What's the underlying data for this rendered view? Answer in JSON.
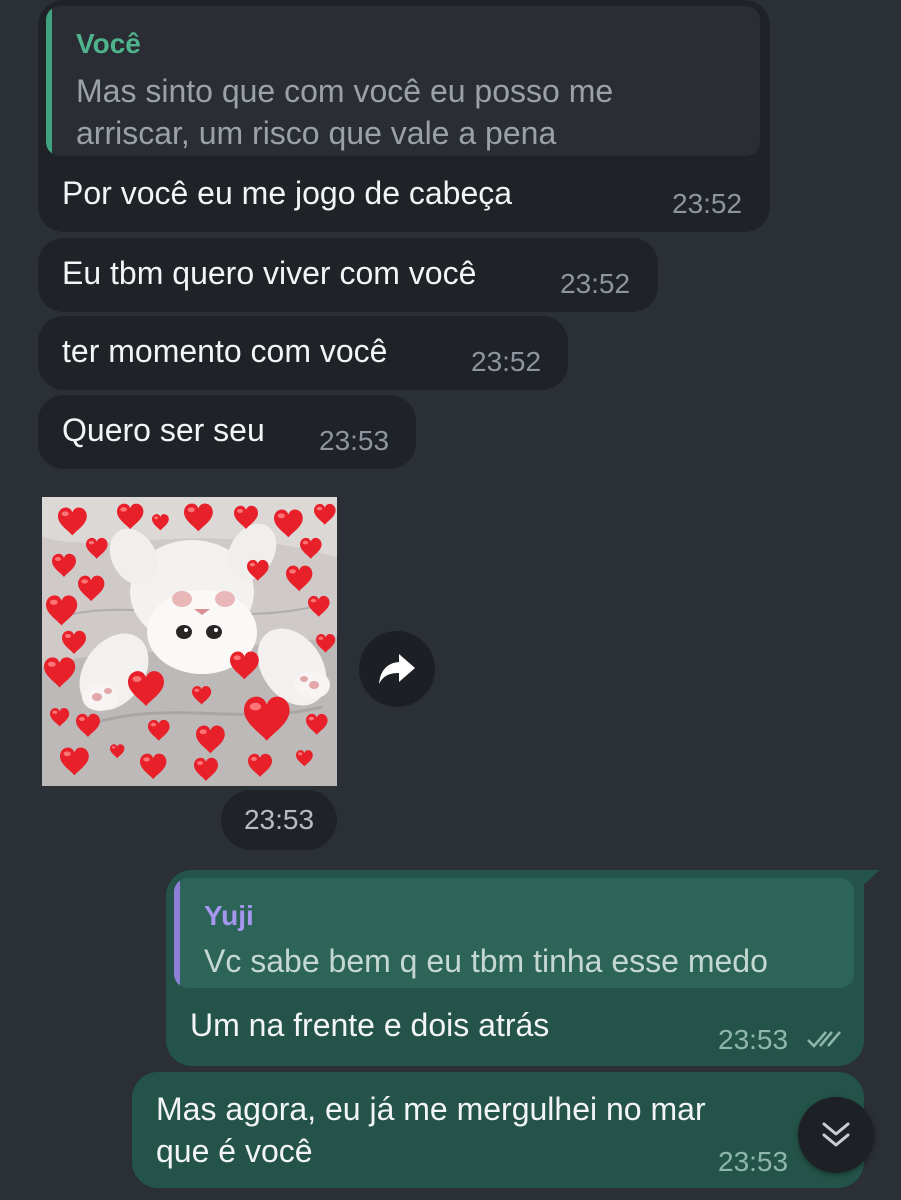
{
  "messages": {
    "m1": {
      "quote_author": "Você",
      "quote_line1": "Mas sinto que com você eu posso me",
      "quote_line2": "arriscar, um risco que vale a pena",
      "text": "Por você eu me jogo de cabeça",
      "time": "23:52"
    },
    "m2": {
      "text": "Eu tbm quero viver com você",
      "time": "23:52"
    },
    "m3": {
      "text": "ter momento com você",
      "time": "23:52"
    },
    "m4": {
      "text": "Quero ser seu",
      "time": "23:53"
    },
    "sticker": {
      "icon": "cat-with-hearts-sticker",
      "time": "23:53",
      "forward_icon": "forward-arrow-icon"
    },
    "m5": {
      "quote_author": "Yuji",
      "quote_text": "Vc sabe bem q eu tbm tinha esse medo",
      "text": "Um na frente e dois atrás",
      "time": "23:53",
      "status_icon": "double-check-icon"
    },
    "m6": {
      "line1": "Mas agora, eu já me mergulhei no mar",
      "line2": "que é você",
      "time": "23:53"
    }
  },
  "scroll_button": {
    "icon": "double-chevron-down-icon"
  },
  "colors": {
    "background": "#2b2f36",
    "incoming_bubble": "#1f2227",
    "outgoing_bubble": "#245449",
    "quote_accent_green": "#3fa37e",
    "quote_accent_purple": "#8c7fd6"
  }
}
